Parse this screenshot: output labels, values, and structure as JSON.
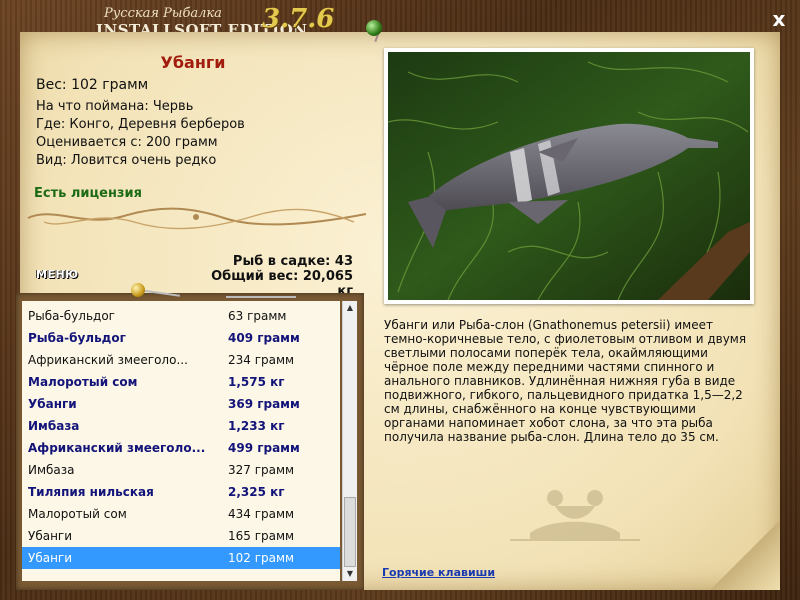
{
  "app": {
    "title_small": "Русская Рыбалка",
    "title_big": "INSTALLSOFT EDITION",
    "version": "3.7.6",
    "close_label": "x"
  },
  "fish": {
    "name": "Убанги",
    "weight_line": "Вес: 102 грамм",
    "caught_on": "На что поймана: Червь",
    "where": "Где: Конго, Деревня берберов",
    "valued_from": "Оценивается с: 200 грамм",
    "kind": "Вид: Ловится очень редко",
    "license": "Есть лицензия"
  },
  "stats": {
    "in_keepnet": "Рыб в садке: 43",
    "total_weight": "Общий вес: 20,065 кг"
  },
  "menu_label": "МЕНЮ",
  "catch_list": [
    {
      "name": "Рыба-бульдог",
      "weight": "63 грамм",
      "bold": false
    },
    {
      "name": "Рыба-бульдог",
      "weight": "409 грамм",
      "bold": true
    },
    {
      "name": "Африканский змееголо...",
      "weight": "234 грамм",
      "bold": false
    },
    {
      "name": "Малоротый сом",
      "weight": "1,575 кг",
      "bold": true
    },
    {
      "name": "Убанги",
      "weight": "369 грамм",
      "bold": true
    },
    {
      "name": "Имбаза",
      "weight": "1,233 кг",
      "bold": true
    },
    {
      "name": "Африканский змееголо...",
      "weight": "499 грамм",
      "bold": true
    },
    {
      "name": "Имбаза",
      "weight": "327 грамм",
      "bold": false
    },
    {
      "name": "Тиляпия нильская",
      "weight": "2,325 кг",
      "bold": true
    },
    {
      "name": "Малоротый сом",
      "weight": "434 грамм",
      "bold": false
    },
    {
      "name": "Убанги",
      "weight": "165 грамм",
      "bold": false
    },
    {
      "name": "Убанги",
      "weight": "102 грамм",
      "bold": false,
      "selected": true
    }
  ],
  "scroll": {
    "up_arrow": "▲",
    "down_arrow": "▼"
  },
  "description": "Убанги или Рыба-слон (Gnathonemus petersii) имеет темно-коричневые тело, с фиолетовым отливом и двумя светлыми полосами поперёк тела, окаймляющими чёрное поле между передними частями спинного и анального плавников. Удлинённая нижняя губа в виде подвижного, гибкого, пальцевидного придатка 1,5—2,2 см длины, снабжённого на конце чувствующими органами напоминает хобот слона, за что эта рыба получила название рыба-слон. Длина тело до 35 см.",
  "hotkeys_label": "Горячие клавиши",
  "colors": {
    "fish_name": "#a21c0e",
    "license": "#1d6b15",
    "bold_row": "#13147a",
    "selected_row": "#3399ff",
    "link": "#1a3bb0",
    "version": "#e4c94f"
  }
}
